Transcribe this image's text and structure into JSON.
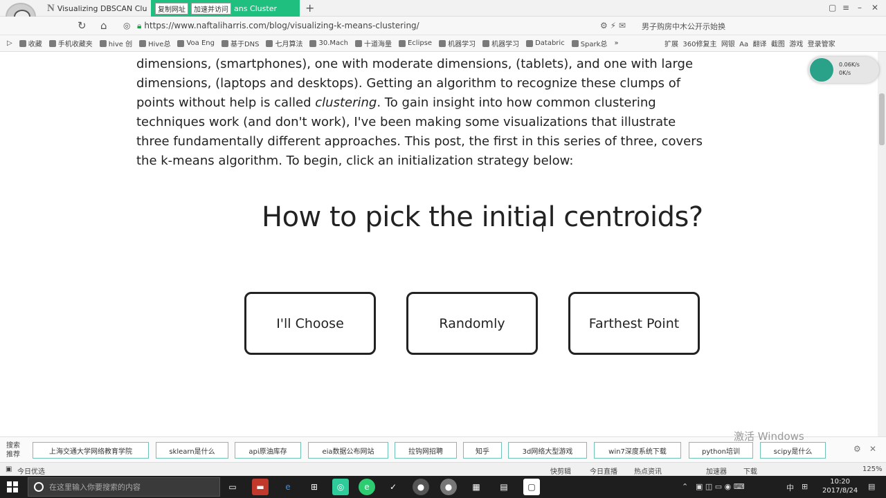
{
  "tabs": [
    {
      "title": "Visualizing DBSCAN Cluste"
    },
    {
      "chip1": "复制网址",
      "chip2": "加速并访问",
      "title": "ans Cluster"
    }
  ],
  "address": {
    "url": "https://www.naftaliharris.com/blog/visualizing-k-means-clustering/",
    "search_hint": "男子购房中木公开示始换"
  },
  "bookmarks": [
    "收藏",
    "手机收藏夹",
    "hive 创",
    "Hive总",
    "Voa Eng",
    "基于DNS",
    "七月算法",
    "30.Mach",
    "十道海量",
    "Eclipse",
    "机器学习",
    "机器学习",
    "Databric",
    "Spark总"
  ],
  "bookmarks_right": [
    "扩展",
    "360修复主",
    "网银",
    "Aa",
    "翻译",
    "截图",
    "游戏",
    "登录管家"
  ],
  "network": {
    "up": "0.06K/s",
    "down": "0K/s"
  },
  "article": {
    "lines": [
      "dimensions, (smartphones), one with moderate dimensions, (tablets), and one with large",
      "dimensions, (laptops and desktops). Getting an algorithm to recognize these clumps of"
    ],
    "line3_pre": "points without help is called ",
    "line3_em": "clustering",
    "line3_post": ". To gain insight into how common clustering",
    "lines_after": [
      "techniques work (and don't work), I've been making some visualizations that illustrate",
      "three fundamentally different approaches. This post, the first in this series of three, covers",
      "the k-means algorithm. To begin, click an initialization strategy below:"
    ],
    "heading": "How to pick the initial centroids?",
    "choices": [
      "I'll Choose",
      "Randomly",
      "Farthest Point"
    ]
  },
  "hot_search": {
    "label_top": "搜索",
    "label_bottom": "推荐",
    "items": [
      "上海交通大学网络教育学院",
      "sklearn是什么",
      "api原油库存",
      "eia数据公布网站",
      "拉钩网招聘",
      "知乎",
      "3d网络大型游戏",
      "win7深度系统下载",
      "python培训",
      "scipy是什么"
    ],
    "watermark": "激活 Windows"
  },
  "status": {
    "left": "今日优选",
    "items": [
      "快剪辑",
      "今日直播",
      "热点资讯",
      "加速器",
      "下载",
      "125%"
    ]
  },
  "taskbar": {
    "search_placeholder": "在这里输入你要搜索的内容",
    "time": "10:20",
    "date": "2017/8/24",
    "ime": "中"
  }
}
